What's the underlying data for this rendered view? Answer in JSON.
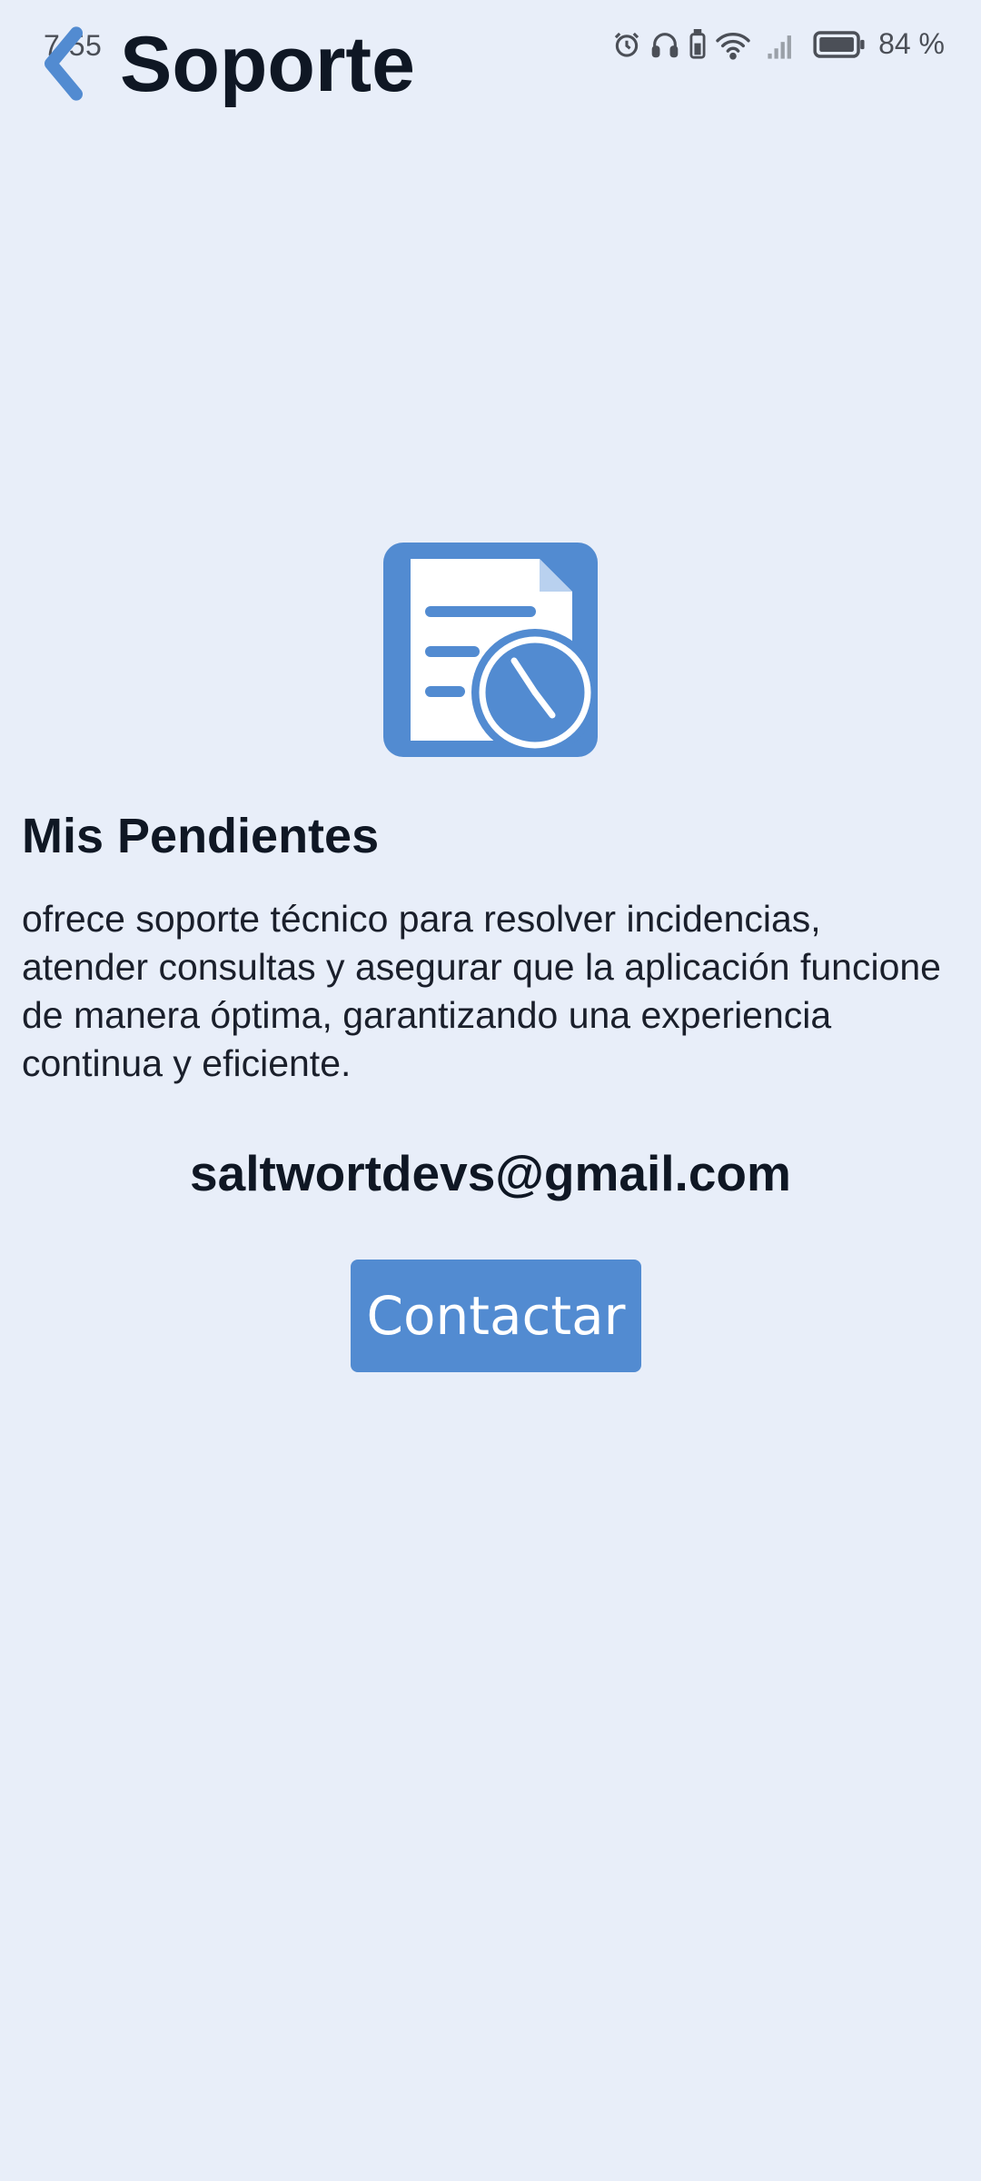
{
  "status_bar": {
    "time": "7:55",
    "battery_text": "84 %",
    "icons": [
      "alarm-icon",
      "headphones-icon",
      "battery-saver-icon",
      "wifi-icon",
      "signal-icon",
      "battery-icon"
    ]
  },
  "header": {
    "back_icon": "chevron-left-icon",
    "title": "Soporte"
  },
  "logo": {
    "icon": "document-clock-icon"
  },
  "content": {
    "app_name": "Mis Pendientes",
    "description": "ofrece soporte técnico para resolver incidencias, atender consultas y asegurar que la aplicación funcione de manera óptima, garantizando una experiencia continua y eficiente.",
    "email": "saltwortdevs@gmail.com",
    "contact_label": "Contactar"
  },
  "colors": {
    "background": "#e8eef9",
    "accent": "#528bd1",
    "text": "#0f1724"
  }
}
